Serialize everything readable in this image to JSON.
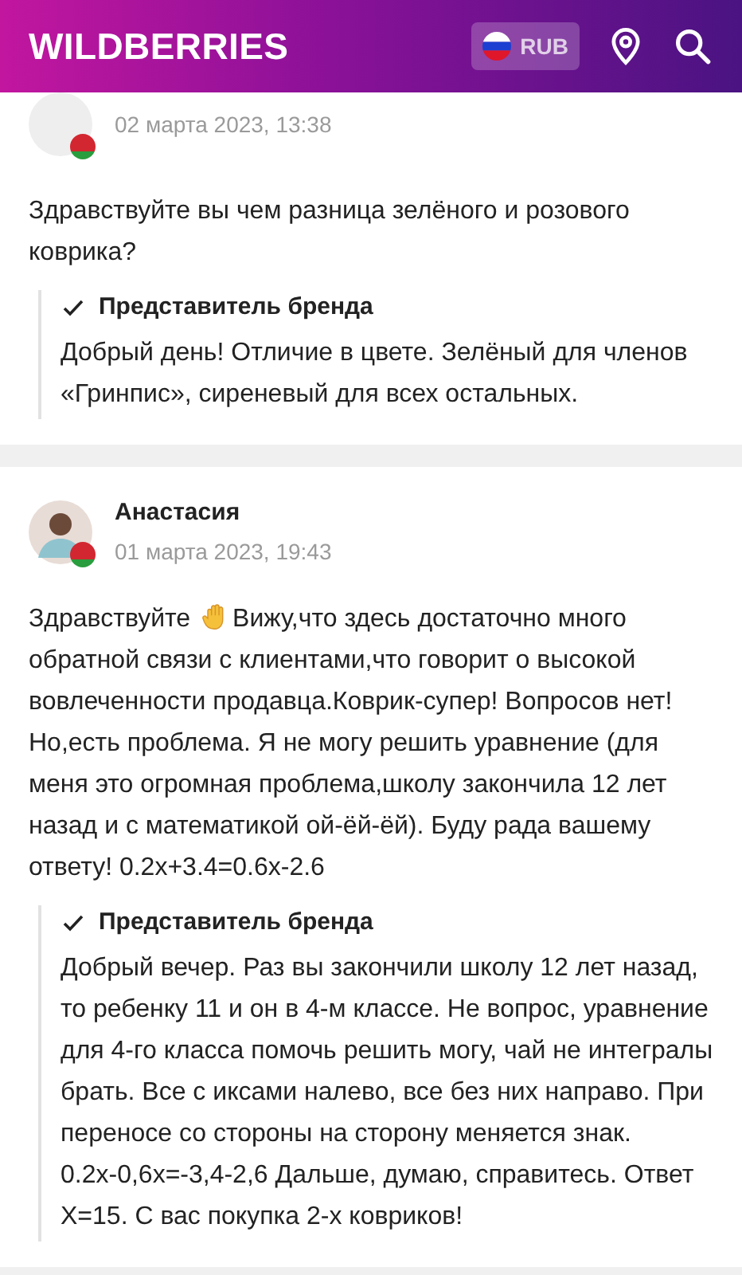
{
  "header": {
    "logo": "WILDBERRIES",
    "currency": "RUB"
  },
  "reviews": [
    {
      "kind": "blank",
      "date": "02 марта 2023, 13:38",
      "text": "Здравствуйте вы чем разница зелёного и розового коврика?",
      "answer": {
        "title": "Представитель бренда",
        "text": "Добрый день! Отличие в цвете. Зелёный для членов «Гринпис», сиреневый для всех остальных."
      }
    },
    {
      "author": "Анастасия",
      "kind": "photo",
      "date": "01 марта 2023, 19:43",
      "greeting": "Здравствуйте",
      "text": "Вижу,что здесь достаточно много обратной связи с клиентами,что говорит о высокой вовлеченности продавца.Коврик-супер! Вопросов нет! Но,есть проблема. Я не могу решить уравнение (для меня это огромная проблема,школу закончила 12 лет назад и с математикой ой-ёй-ёй). Буду рада вашему ответу! 0.2х+3.4=0.6х-2.6",
      "answer": {
        "title": "Представитель бренда",
        "text": "Добрый вечер. Раз вы закончили школу 12 лет назад, то ребенку 11 и он в 4-м классе. Не вопрос, уравнение для 4-го класса помочь решить могу, чай не интегралы брать. Все с иксами налево, все без них направо. При переносе со стороны на сторону меняется знак. 0.2х-0,6х=-3,4-2,6 Дальше, думаю, справитесь. Ответ Х=15. С вас покупка 2-х ковриков!"
      }
    }
  ]
}
